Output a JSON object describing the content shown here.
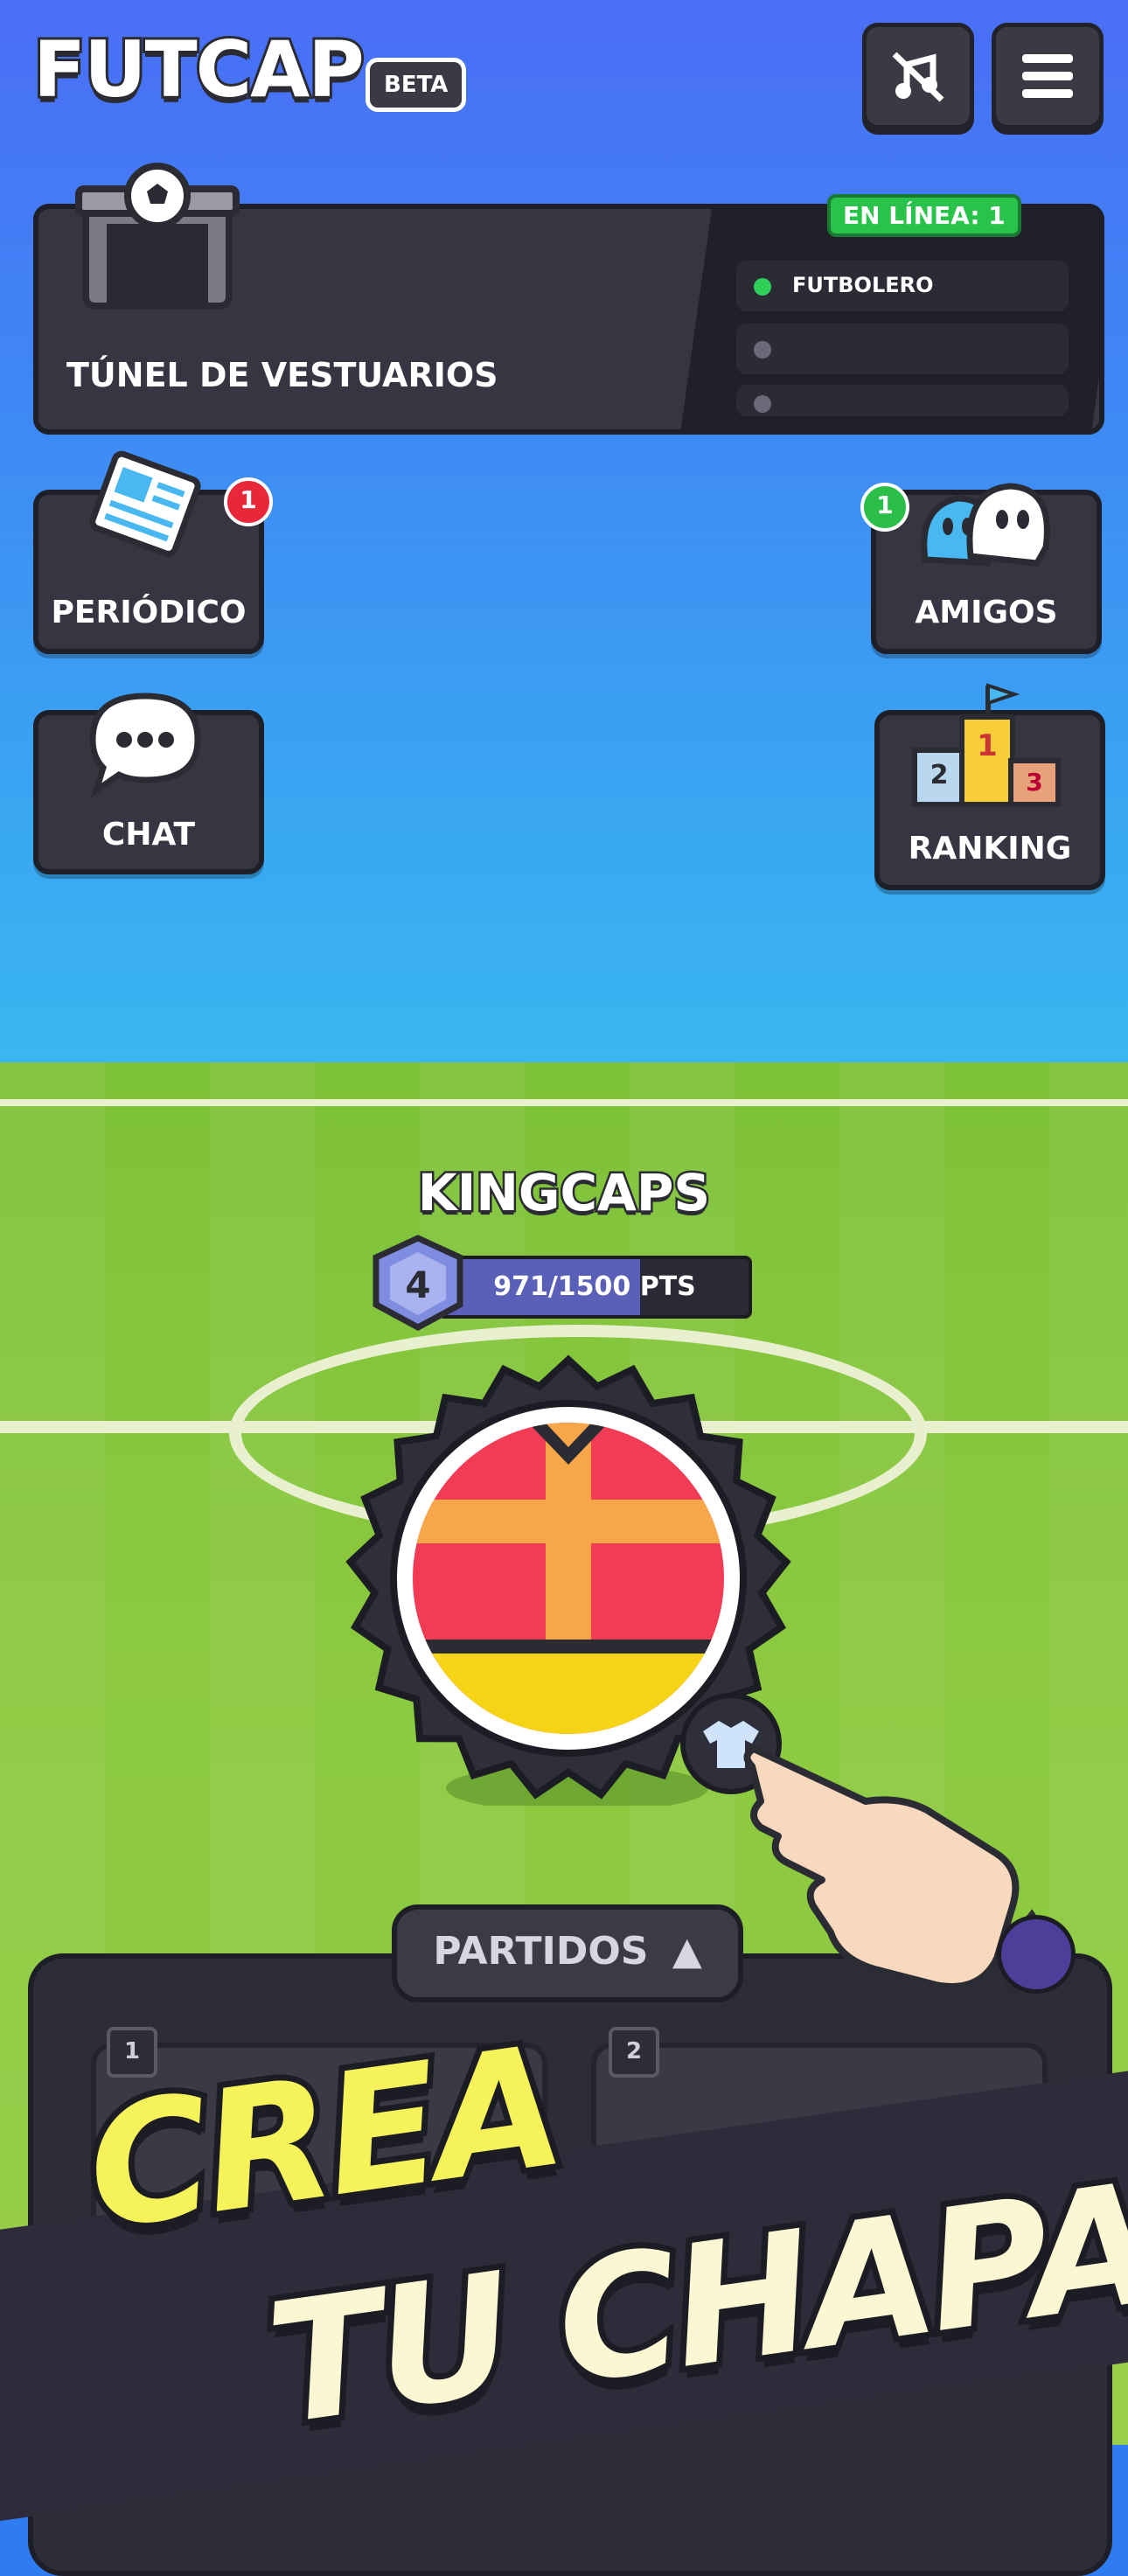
{
  "app": {
    "logo": "FUTCAP",
    "beta": "BETA"
  },
  "header": {
    "mute_icon": "music-off-icon",
    "menu_icon": "menu-icon"
  },
  "tunnel": {
    "title": "TÚNEL DE VESTUARIOS",
    "online_label": "EN LÍNEA: 1",
    "players": [
      {
        "name": "FUTBOLERO",
        "online": true
      },
      {
        "name": "",
        "online": false
      },
      {
        "name": "",
        "online": false
      }
    ]
  },
  "side": {
    "periodico": {
      "label": "PERIÓDICO",
      "badge": "1"
    },
    "amigos": {
      "label": "AMIGOS",
      "badge": "1"
    },
    "chat": {
      "label": "CHAT"
    },
    "ranking": {
      "label": "RANKING",
      "podium": [
        "2",
        "1",
        "3"
      ]
    }
  },
  "player": {
    "name": "KINGCAPS",
    "level": "4",
    "points": "971/1500 PTS",
    "progress_fraction": 0.647
  },
  "matches": {
    "tab_label": "PARTIDOS",
    "slots": [
      "1",
      "2"
    ]
  },
  "promo": {
    "line1": "CREA",
    "line2": "TU CHAPA"
  },
  "colors": {
    "online": "#29c24b",
    "badge_red": "#e8273a",
    "badge_green": "#2bbf4a",
    "promo_yellow": "#f5f25a",
    "promo_cream": "#fbf7d2"
  }
}
